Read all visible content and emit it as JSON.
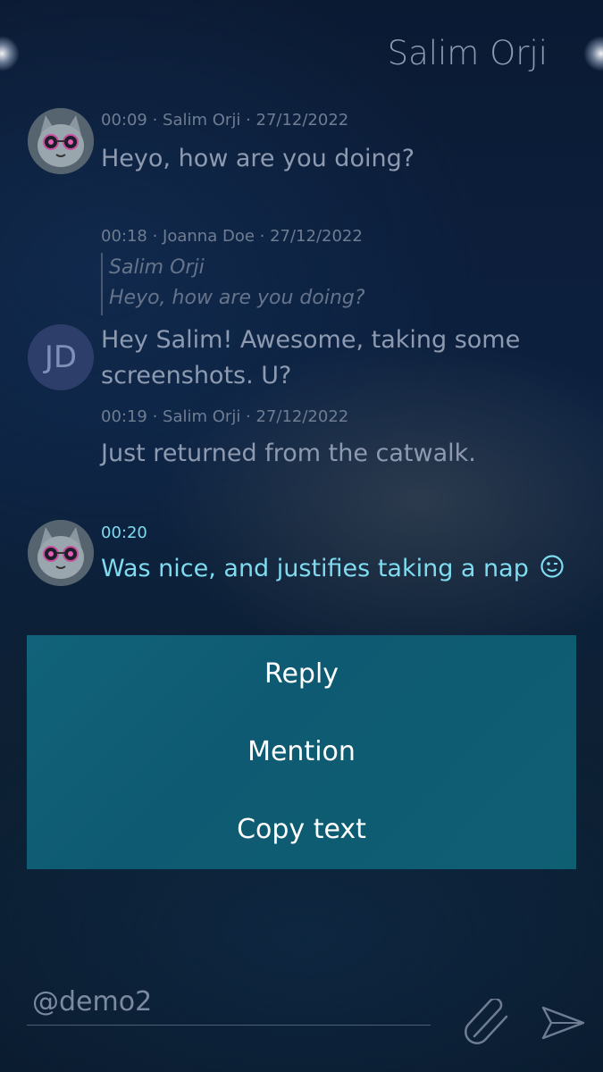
{
  "header": {
    "title": "Salim Orji"
  },
  "messages": [
    {
      "meta": "00:09 · Salim Orji · 27/12/2022",
      "text": "Heyo, how are you doing?"
    },
    {
      "meta": "00:18 · Joanna Doe · 27/12/2022",
      "quote_author": "Salim Orji",
      "quote_text": "Heyo, how are you doing?",
      "avatar_initials": "JD",
      "text_line1": "Hey Salim! Awesome, taking some",
      "text_line2": "screenshots. U?"
    },
    {
      "meta": "00:19 · Salim Orji · 27/12/2022",
      "text": "Just returned from the catwalk."
    },
    {
      "meta": "00:20",
      "text": "Was nice, and justifies taking a nap"
    }
  ],
  "context_menu": {
    "items": [
      "Reply",
      "Mention",
      "Copy text"
    ]
  },
  "composer": {
    "value": "@demo2"
  },
  "icons": {
    "attach": "paperclip-icon",
    "send": "send-icon",
    "emoji": "wink-emoji-icon"
  },
  "colors": {
    "menu_bg": "#0f5f73",
    "highlight_text": "#7fdbef",
    "background": "#0c2140"
  }
}
